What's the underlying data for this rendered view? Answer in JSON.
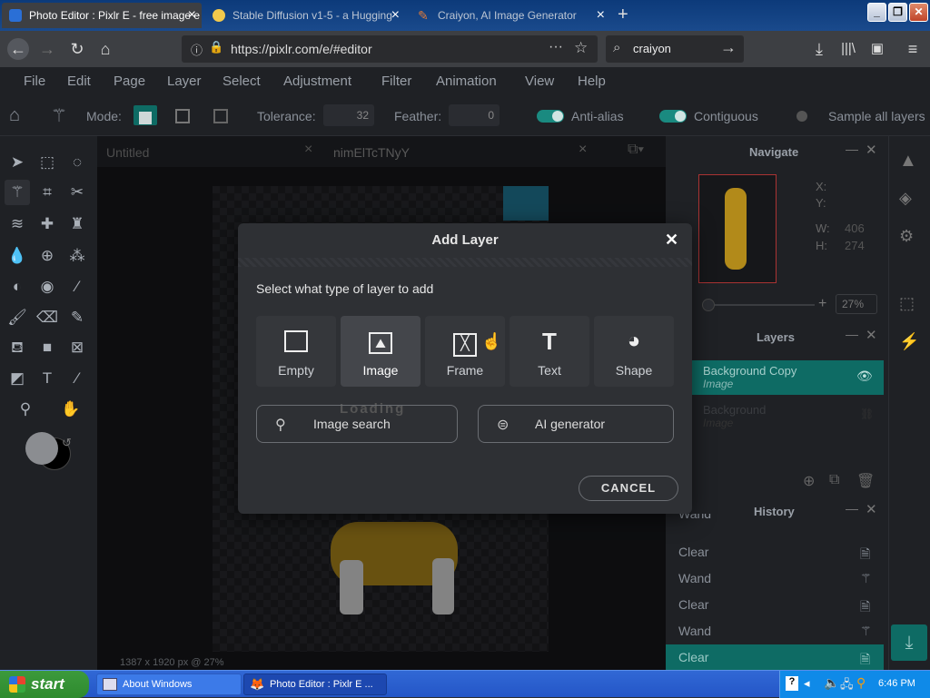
{
  "browser": {
    "tabs": [
      {
        "title": "Photo Editor : Pixlr E - free image e",
        "active": true
      },
      {
        "title": "Stable Diffusion v1-5 - a Hugging",
        "active": false
      },
      {
        "title": "Craiyon, AI Image Generator",
        "active": false
      }
    ],
    "url": "https://pixlr.com/e/#editor",
    "search_value": "craiyon",
    "win_buttons": [
      "_",
      "❐",
      "✕"
    ]
  },
  "menubar": [
    "File",
    "Edit",
    "Page",
    "Layer",
    "Select",
    "Adjustment",
    "Filter",
    "Animation",
    "View",
    "Help"
  ],
  "options": {
    "mode_label": "Mode:",
    "tolerance_label": "Tolerance:",
    "tolerance_value": "32",
    "feather_label": "Feather:",
    "feather_value": "0",
    "antialias_label": "Anti-alias",
    "contiguous_label": "Contiguous",
    "sample_label": "Sample all layers"
  },
  "doc_tabs": [
    "Untitled",
    "nimElTcTNyY"
  ],
  "doc_info": "1387 x 1920 px @ 27%",
  "navigate": {
    "title": "Navigate",
    "x_label": "X:",
    "y_label": "Y:",
    "w_label": "W:",
    "w_value": "406",
    "h_label": "H:",
    "h_value": "274",
    "zoom": "27%"
  },
  "layers": {
    "title": "Layers",
    "items": [
      {
        "name": "Background Copy",
        "type": "Image",
        "selected": true
      },
      {
        "name": "Background",
        "type": "Image",
        "selected": false
      }
    ]
  },
  "history": {
    "title": "History",
    "items": [
      {
        "label": "Wand",
        "selected": false
      },
      {
        "label": "Clear",
        "selected": false
      },
      {
        "label": "Wand",
        "selected": false
      },
      {
        "label": "Clear",
        "selected": false
      },
      {
        "label": "Wand",
        "selected": false
      },
      {
        "label": "Clear",
        "selected": true
      }
    ]
  },
  "modal": {
    "title": "Add Layer",
    "prompt": "Select what type of layer to add",
    "types": [
      {
        "label": "Empty",
        "icon": "empty-square-icon"
      },
      {
        "label": "Image",
        "icon": "image-icon"
      },
      {
        "label": "Frame",
        "icon": "frame-icon"
      },
      {
        "label": "Text",
        "icon": "text-icon"
      },
      {
        "label": "Shape",
        "icon": "shape-icon"
      }
    ],
    "loading": "Loading",
    "image_search_label": "Image search",
    "ai_generator_label": "AI generator",
    "cancel_label": "CANCEL"
  },
  "taskbar": {
    "start": "start",
    "items": [
      "About Windows",
      "Photo Editor : Pixlr E ..."
    ],
    "clock": "6:46 PM"
  },
  "colors": {
    "accent": "#0e6b64",
    "toggle_on": "#1a8a80",
    "modal_bg": "#2e3034",
    "app_bg": "#1f2125"
  }
}
